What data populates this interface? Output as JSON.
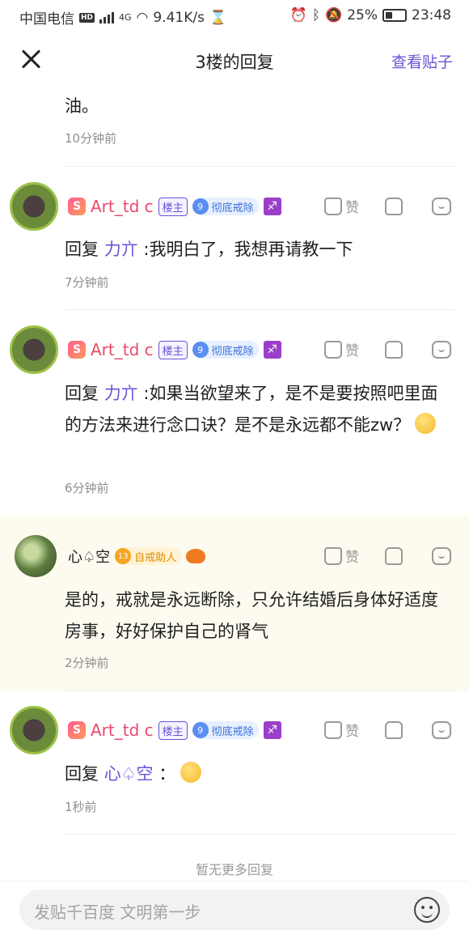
{
  "status": {
    "carrier": "中国电信",
    "hd": "HD",
    "network": "4G",
    "speed": "9.41K/s",
    "battery": "25%",
    "time": "23:48"
  },
  "nav": {
    "title": "3楼的回复",
    "view_post": "查看贴子"
  },
  "top": {
    "text": "油。",
    "time": "10分钟前"
  },
  "replies": [
    {
      "user": "Art_td c",
      "level_icon": "S",
      "badge_lz": "楼主",
      "level_num": "9",
      "level_name": "彻底戒除",
      "reply_label": "回复",
      "mention": "力亣",
      "text": ":我明白了，我想再请教一下",
      "time": "7分钟前",
      "like": "赞"
    },
    {
      "user": "Art_td c",
      "level_icon": "S",
      "badge_lz": "楼主",
      "level_num": "9",
      "level_name": "彻底戒除",
      "reply_label": "回复",
      "mention": "力亣",
      "text": ":如果当欲望来了，是不是要按照吧里面的方法来进行念口诀？是不是永远都不能zw？",
      "time": "6分钟前",
      "like": "赞"
    },
    {
      "user": "心♤空",
      "level_num": "13",
      "level_name": "自戒助人",
      "text": "是的，戒就是永远断除，只允许结婚后身体好适度房事，好好保护自己的肾气",
      "time": "2分钟前",
      "like": "赞"
    },
    {
      "user": "Art_td c",
      "level_icon": "S",
      "badge_lz": "楼主",
      "level_num": "9",
      "level_name": "彻底戒除",
      "reply_label": "回复",
      "mention": "心♤空",
      "text": "：",
      "time": "1秒前",
      "like": "赞"
    }
  ],
  "no_more": "暂无更多回复",
  "input": {
    "placeholder": "发贴千百度 文明第一步"
  },
  "colors": {
    "accent": "#6b52d9",
    "username": "#e8496b",
    "highlight_bg": "#fdfbef"
  }
}
